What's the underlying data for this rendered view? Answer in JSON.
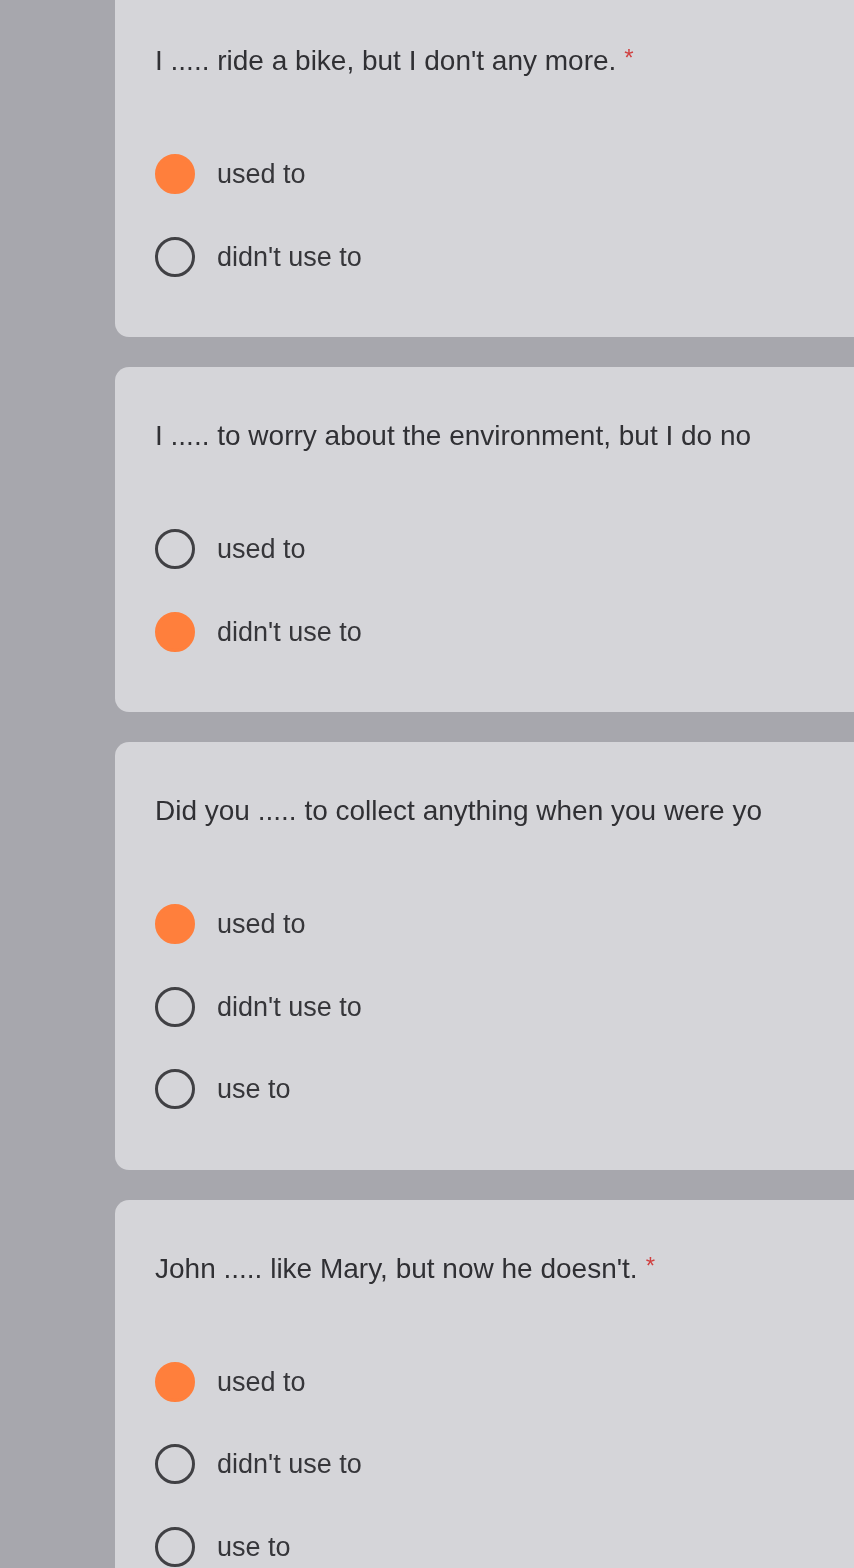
{
  "questions": [
    {
      "text": "I ..... ride a bike, but I don't any more.",
      "required_mark": "*",
      "options": [
        {
          "label": "used to",
          "selected": true
        },
        {
          "label": "didn't use to",
          "selected": false
        }
      ]
    },
    {
      "text": "I ..... to worry about the environment, but I do no",
      "options": [
        {
          "label": "used to",
          "selected": false
        },
        {
          "label": "didn't use to",
          "selected": true
        }
      ]
    },
    {
      "text": "Did you ..... to collect anything when you were yo",
      "options": [
        {
          "label": "used to",
          "selected": true
        },
        {
          "label": "didn't use to",
          "selected": false
        },
        {
          "label": "use to",
          "selected": false
        }
      ]
    },
    {
      "text": "John ..... like Mary, but now he doesn't.",
      "required_mark": "*",
      "options": [
        {
          "label": "used to",
          "selected": true
        },
        {
          "label": "didn't use to",
          "selected": false
        },
        {
          "label": "use to",
          "selected": false
        }
      ]
    }
  ]
}
